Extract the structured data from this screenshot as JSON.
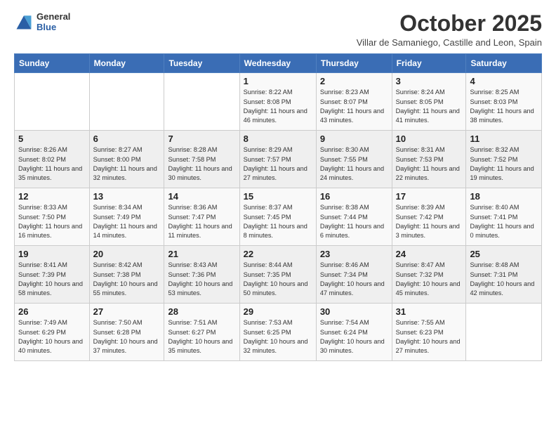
{
  "header": {
    "logo_general": "General",
    "logo_blue": "Blue",
    "month_title": "October 2025",
    "subtitle": "Villar de Samaniego, Castille and Leon, Spain"
  },
  "weekdays": [
    "Sunday",
    "Monday",
    "Tuesday",
    "Wednesday",
    "Thursday",
    "Friday",
    "Saturday"
  ],
  "weeks": [
    [
      {
        "day": "",
        "sunrise": "",
        "sunset": "",
        "daylight": ""
      },
      {
        "day": "",
        "sunrise": "",
        "sunset": "",
        "daylight": ""
      },
      {
        "day": "",
        "sunrise": "",
        "sunset": "",
        "daylight": ""
      },
      {
        "day": "1",
        "sunrise": "Sunrise: 8:22 AM",
        "sunset": "Sunset: 8:08 PM",
        "daylight": "Daylight: 11 hours and 46 minutes."
      },
      {
        "day": "2",
        "sunrise": "Sunrise: 8:23 AM",
        "sunset": "Sunset: 8:07 PM",
        "daylight": "Daylight: 11 hours and 43 minutes."
      },
      {
        "day": "3",
        "sunrise": "Sunrise: 8:24 AM",
        "sunset": "Sunset: 8:05 PM",
        "daylight": "Daylight: 11 hours and 41 minutes."
      },
      {
        "day": "4",
        "sunrise": "Sunrise: 8:25 AM",
        "sunset": "Sunset: 8:03 PM",
        "daylight": "Daylight: 11 hours and 38 minutes."
      }
    ],
    [
      {
        "day": "5",
        "sunrise": "Sunrise: 8:26 AM",
        "sunset": "Sunset: 8:02 PM",
        "daylight": "Daylight: 11 hours and 35 minutes."
      },
      {
        "day": "6",
        "sunrise": "Sunrise: 8:27 AM",
        "sunset": "Sunset: 8:00 PM",
        "daylight": "Daylight: 11 hours and 32 minutes."
      },
      {
        "day": "7",
        "sunrise": "Sunrise: 8:28 AM",
        "sunset": "Sunset: 7:58 PM",
        "daylight": "Daylight: 11 hours and 30 minutes."
      },
      {
        "day": "8",
        "sunrise": "Sunrise: 8:29 AM",
        "sunset": "Sunset: 7:57 PM",
        "daylight": "Daylight: 11 hours and 27 minutes."
      },
      {
        "day": "9",
        "sunrise": "Sunrise: 8:30 AM",
        "sunset": "Sunset: 7:55 PM",
        "daylight": "Daylight: 11 hours and 24 minutes."
      },
      {
        "day": "10",
        "sunrise": "Sunrise: 8:31 AM",
        "sunset": "Sunset: 7:53 PM",
        "daylight": "Daylight: 11 hours and 22 minutes."
      },
      {
        "day": "11",
        "sunrise": "Sunrise: 8:32 AM",
        "sunset": "Sunset: 7:52 PM",
        "daylight": "Daylight: 11 hours and 19 minutes."
      }
    ],
    [
      {
        "day": "12",
        "sunrise": "Sunrise: 8:33 AM",
        "sunset": "Sunset: 7:50 PM",
        "daylight": "Daylight: 11 hours and 16 minutes."
      },
      {
        "day": "13",
        "sunrise": "Sunrise: 8:34 AM",
        "sunset": "Sunset: 7:49 PM",
        "daylight": "Daylight: 11 hours and 14 minutes."
      },
      {
        "day": "14",
        "sunrise": "Sunrise: 8:36 AM",
        "sunset": "Sunset: 7:47 PM",
        "daylight": "Daylight: 11 hours and 11 minutes."
      },
      {
        "day": "15",
        "sunrise": "Sunrise: 8:37 AM",
        "sunset": "Sunset: 7:45 PM",
        "daylight": "Daylight: 11 hours and 8 minutes."
      },
      {
        "day": "16",
        "sunrise": "Sunrise: 8:38 AM",
        "sunset": "Sunset: 7:44 PM",
        "daylight": "Daylight: 11 hours and 6 minutes."
      },
      {
        "day": "17",
        "sunrise": "Sunrise: 8:39 AM",
        "sunset": "Sunset: 7:42 PM",
        "daylight": "Daylight: 11 hours and 3 minutes."
      },
      {
        "day": "18",
        "sunrise": "Sunrise: 8:40 AM",
        "sunset": "Sunset: 7:41 PM",
        "daylight": "Daylight: 11 hours and 0 minutes."
      }
    ],
    [
      {
        "day": "19",
        "sunrise": "Sunrise: 8:41 AM",
        "sunset": "Sunset: 7:39 PM",
        "daylight": "Daylight: 10 hours and 58 minutes."
      },
      {
        "day": "20",
        "sunrise": "Sunrise: 8:42 AM",
        "sunset": "Sunset: 7:38 PM",
        "daylight": "Daylight: 10 hours and 55 minutes."
      },
      {
        "day": "21",
        "sunrise": "Sunrise: 8:43 AM",
        "sunset": "Sunset: 7:36 PM",
        "daylight": "Daylight: 10 hours and 53 minutes."
      },
      {
        "day": "22",
        "sunrise": "Sunrise: 8:44 AM",
        "sunset": "Sunset: 7:35 PM",
        "daylight": "Daylight: 10 hours and 50 minutes."
      },
      {
        "day": "23",
        "sunrise": "Sunrise: 8:46 AM",
        "sunset": "Sunset: 7:34 PM",
        "daylight": "Daylight: 10 hours and 47 minutes."
      },
      {
        "day": "24",
        "sunrise": "Sunrise: 8:47 AM",
        "sunset": "Sunset: 7:32 PM",
        "daylight": "Daylight: 10 hours and 45 minutes."
      },
      {
        "day": "25",
        "sunrise": "Sunrise: 8:48 AM",
        "sunset": "Sunset: 7:31 PM",
        "daylight": "Daylight: 10 hours and 42 minutes."
      }
    ],
    [
      {
        "day": "26",
        "sunrise": "Sunrise: 7:49 AM",
        "sunset": "Sunset: 6:29 PM",
        "daylight": "Daylight: 10 hours and 40 minutes."
      },
      {
        "day": "27",
        "sunrise": "Sunrise: 7:50 AM",
        "sunset": "Sunset: 6:28 PM",
        "daylight": "Daylight: 10 hours and 37 minutes."
      },
      {
        "day": "28",
        "sunrise": "Sunrise: 7:51 AM",
        "sunset": "Sunset: 6:27 PM",
        "daylight": "Daylight: 10 hours and 35 minutes."
      },
      {
        "day": "29",
        "sunrise": "Sunrise: 7:53 AM",
        "sunset": "Sunset: 6:25 PM",
        "daylight": "Daylight: 10 hours and 32 minutes."
      },
      {
        "day": "30",
        "sunrise": "Sunrise: 7:54 AM",
        "sunset": "Sunset: 6:24 PM",
        "daylight": "Daylight: 10 hours and 30 minutes."
      },
      {
        "day": "31",
        "sunrise": "Sunrise: 7:55 AM",
        "sunset": "Sunset: 6:23 PM",
        "daylight": "Daylight: 10 hours and 27 minutes."
      },
      {
        "day": "",
        "sunrise": "",
        "sunset": "",
        "daylight": ""
      }
    ]
  ]
}
